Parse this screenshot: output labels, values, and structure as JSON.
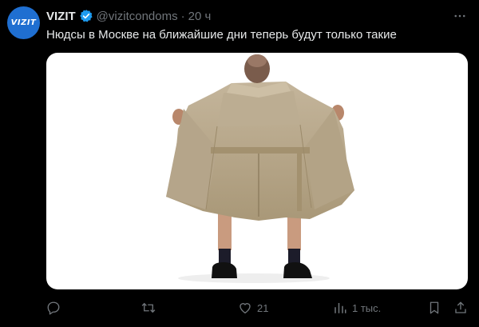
{
  "tweet": {
    "avatar_text": "VIZIT",
    "display_name": "VIZIT",
    "handle": "@vizitcondoms",
    "separator": "·",
    "time": "20 ч",
    "text": "Нюдсы в Москве на ближайшие дни теперь будут только такие"
  },
  "actions": {
    "reply_count": "",
    "retweet_count": "",
    "like_count": "21",
    "views_count": "1 тыс."
  },
  "colors": {
    "background": "#000000",
    "text": "#e7e9ea",
    "muted": "#71767b",
    "verified": "#1d9bf0",
    "avatar": "#1f6fd1",
    "coat": "#b9a98e"
  },
  "icons": [
    "verified-badge-icon",
    "more-icon",
    "reply-icon",
    "retweet-icon",
    "like-icon",
    "views-icon",
    "bookmark-icon",
    "share-icon"
  ]
}
